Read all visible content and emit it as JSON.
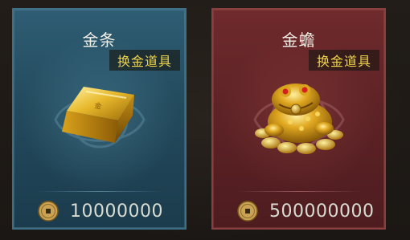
{
  "items": [
    {
      "name": "金条",
      "badge": "换金道具",
      "price": "10000000",
      "icon": "gold-bar-icon",
      "theme": "blue"
    },
    {
      "name": "金蟾",
      "badge": "换金道具",
      "price": "500000000",
      "icon": "golden-toad-icon",
      "theme": "red"
    }
  ],
  "currency_icon": "copper-coin-icon",
  "colors": {
    "blue_card": "#2f5d73",
    "red_card": "#6f2a2c",
    "badge_text": "#f0d44a",
    "title_text": "#f2efe6",
    "price_text": "#d8dcd3"
  }
}
